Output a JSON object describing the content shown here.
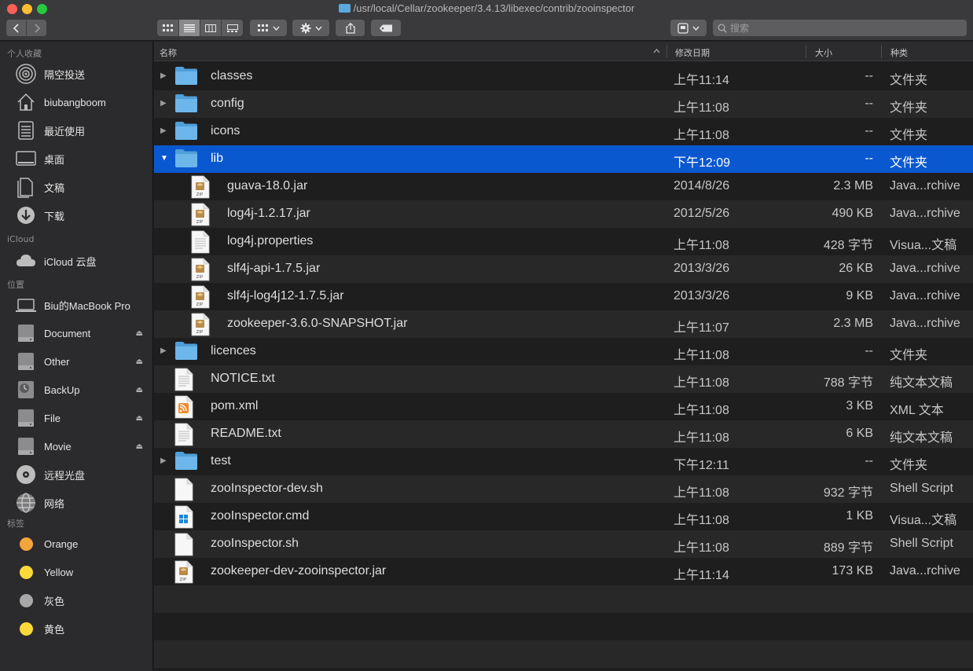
{
  "window": {
    "title": "/usr/local/Cellar/zookeeper/3.4.13/libexec/contrib/zooinspector",
    "search_placeholder": "搜索"
  },
  "colors": {
    "selection": "#0a58d0",
    "folder": "#5aa8de",
    "tag_orange": "#f4a43a",
    "tag_yellow": "#f9d93a",
    "tag_gray": "#a8a8a8"
  },
  "sidebar": {
    "favorites_title": "个人收藏",
    "favorites": [
      {
        "label": "隔空投送",
        "icon": "airdrop-icon"
      },
      {
        "label": "biubangboom",
        "icon": "home-icon"
      },
      {
        "label": "最近使用",
        "icon": "recents-icon"
      },
      {
        "label": "桌面",
        "icon": "desktop-icon"
      },
      {
        "label": "文稿",
        "icon": "documents-icon"
      },
      {
        "label": "下载",
        "icon": "downloads-icon"
      }
    ],
    "icloud_title": "iCloud",
    "icloud": [
      {
        "label": "iCloud 云盘",
        "icon": "cloud-icon"
      }
    ],
    "locations_title": "位置",
    "locations": [
      {
        "label": "Biu的MacBook Pro",
        "icon": "laptop-icon"
      },
      {
        "label": "Document",
        "icon": "drive-icon"
      },
      {
        "label": "Other",
        "icon": "drive-icon"
      },
      {
        "label": "BackUp",
        "icon": "timemachine-icon"
      },
      {
        "label": "File",
        "icon": "drive-icon"
      },
      {
        "label": "Movie",
        "icon": "drive-icon"
      },
      {
        "label": "远程光盘",
        "icon": "disc-icon"
      },
      {
        "label": "网络",
        "icon": "network-icon"
      }
    ],
    "tags_title": "标签",
    "tags": [
      {
        "label": "Orange",
        "color": "#f4a43a"
      },
      {
        "label": "Yellow",
        "color": "#f9d93a"
      },
      {
        "label": "灰色",
        "color": "#a8a8a8"
      },
      {
        "label": "黄色",
        "color": "#f9d93a"
      }
    ]
  },
  "columns": {
    "name": "名称",
    "date": "修改日期",
    "size": "大小",
    "kind": "种类"
  },
  "files": [
    {
      "name": "classes",
      "date": "上午11:14",
      "size": "--",
      "kind": "文件夹",
      "type": "folder",
      "level": 0,
      "disclosure": "closed"
    },
    {
      "name": "config",
      "date": "上午11:08",
      "size": "--",
      "kind": "文件夹",
      "type": "folder",
      "level": 0,
      "disclosure": "closed"
    },
    {
      "name": "icons",
      "date": "上午11:08",
      "size": "--",
      "kind": "文件夹",
      "type": "folder",
      "level": 0,
      "disclosure": "closed"
    },
    {
      "name": "lib",
      "date": "下午12:09",
      "size": "--",
      "kind": "文件夹",
      "type": "folder",
      "level": 0,
      "disclosure": "open",
      "selected": true
    },
    {
      "name": "guava-18.0.jar",
      "date": "2014/8/26",
      "size": "2.3 MB",
      "kind": "Java...rchive",
      "type": "jar",
      "level": 1
    },
    {
      "name": "log4j-1.2.17.jar",
      "date": "2012/5/26",
      "size": "490 KB",
      "kind": "Java...rchive",
      "type": "jar",
      "level": 1
    },
    {
      "name": "log4j.properties",
      "date": "上午11:08",
      "size": "428 字节",
      "kind": "Visua...文稿",
      "type": "text",
      "level": 1
    },
    {
      "name": "slf4j-api-1.7.5.jar",
      "date": "2013/3/26",
      "size": "26 KB",
      "kind": "Java...rchive",
      "type": "jar",
      "level": 1
    },
    {
      "name": "slf4j-log4j12-1.7.5.jar",
      "date": "2013/3/26",
      "size": "9 KB",
      "kind": "Java...rchive",
      "type": "jar",
      "level": 1
    },
    {
      "name": "zookeeper-3.6.0-SNAPSHOT.jar",
      "date": "上午11:07",
      "size": "2.3 MB",
      "kind": "Java...rchive",
      "type": "jar",
      "level": 1
    },
    {
      "name": "licences",
      "date": "上午11:08",
      "size": "--",
      "kind": "文件夹",
      "type": "folder",
      "level": 0,
      "disclosure": "closed"
    },
    {
      "name": "NOTICE.txt",
      "date": "上午11:08",
      "size": "788 字节",
      "kind": "纯文本文稿",
      "type": "text",
      "level": 0
    },
    {
      "name": "pom.xml",
      "date": "上午11:08",
      "size": "3 KB",
      "kind": "XML 文本",
      "type": "xml",
      "level": 0
    },
    {
      "name": "README.txt",
      "date": "上午11:08",
      "size": "6 KB",
      "kind": "纯文本文稿",
      "type": "text",
      "level": 0
    },
    {
      "name": "test",
      "date": "下午12:11",
      "size": "--",
      "kind": "文件夹",
      "type": "folder",
      "level": 0,
      "disclosure": "closed"
    },
    {
      "name": "zooInspector-dev.sh",
      "date": "上午11:08",
      "size": "932 字节",
      "kind": "Shell Script",
      "type": "blank",
      "level": 0
    },
    {
      "name": "zooInspector.cmd",
      "date": "上午11:08",
      "size": "1 KB",
      "kind": "Visua...文稿",
      "type": "cmd",
      "level": 0
    },
    {
      "name": "zooInspector.sh",
      "date": "上午11:08",
      "size": "889 字节",
      "kind": "Shell Script",
      "type": "blank",
      "level": 0
    },
    {
      "name": "zookeeper-dev-zooinspector.jar",
      "date": "上午11:14",
      "size": "173 KB",
      "kind": "Java...rchive",
      "type": "jar",
      "level": 0
    }
  ]
}
